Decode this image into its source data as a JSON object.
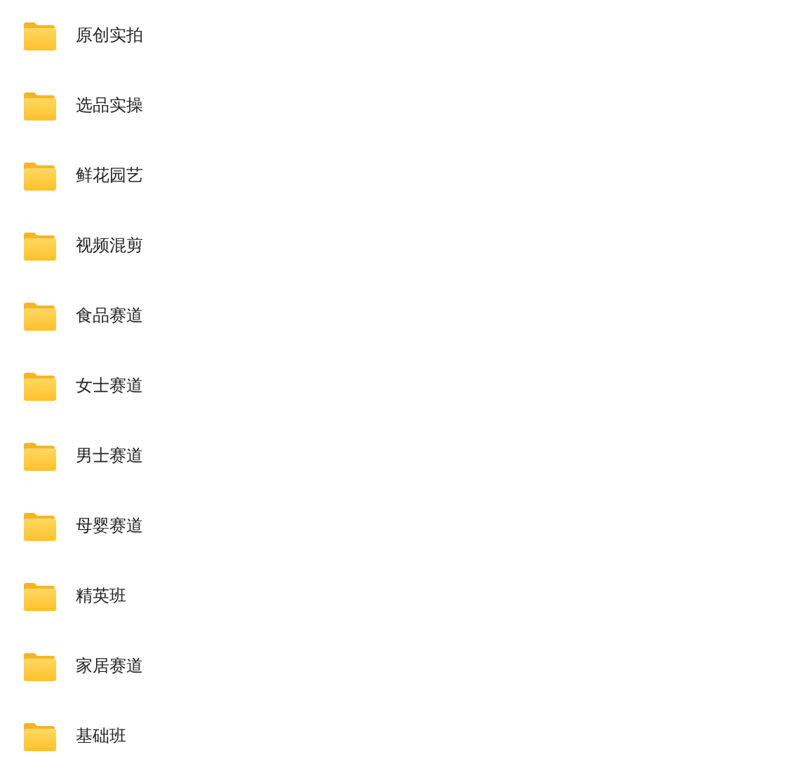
{
  "folders": [
    {
      "name": "原创实拍"
    },
    {
      "name": "选品实操"
    },
    {
      "name": "鲜花园艺"
    },
    {
      "name": "视频混剪"
    },
    {
      "name": "食品赛道"
    },
    {
      "name": "女士赛道"
    },
    {
      "name": "男士赛道"
    },
    {
      "name": "母婴赛道"
    },
    {
      "name": "精英班"
    },
    {
      "name": "家居赛道"
    },
    {
      "name": "基础班"
    }
  ]
}
